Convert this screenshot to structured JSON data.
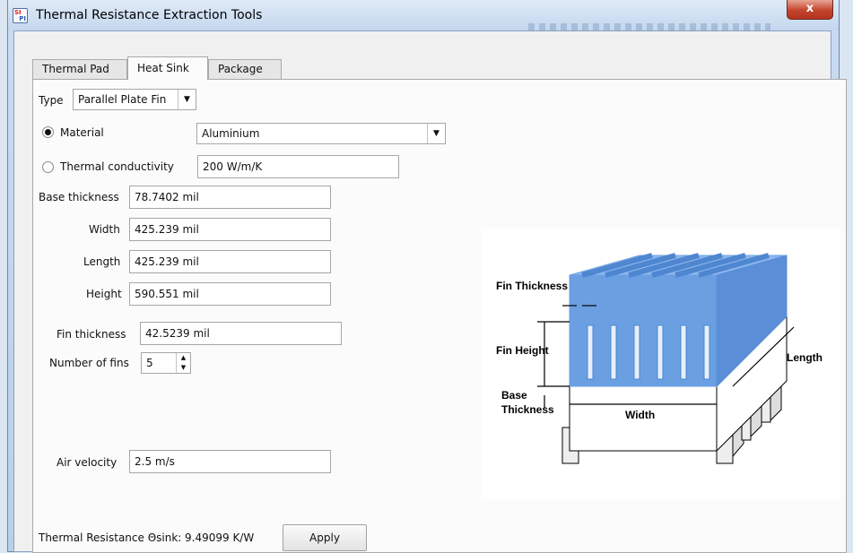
{
  "window": {
    "title": "Thermal Resistance Extraction Tools",
    "icon_text_top": "SI",
    "icon_text_bottom": "PI",
    "close_glyph": "x"
  },
  "tabs": [
    {
      "label": "Thermal Pad",
      "active": false
    },
    {
      "label": "Heat Sink",
      "active": true
    },
    {
      "label": "Package",
      "active": false
    }
  ],
  "form": {
    "type_label": "Type",
    "type_value": "Parallel Plate Fin",
    "material_label": "Material",
    "material_value": "Aluminium",
    "thermal_conductivity_label": "Thermal conductivity",
    "thermal_conductivity_value": "200 W/m/K",
    "base_thickness_label": "Base thickness",
    "base_thickness_value": "78.7402 mil",
    "width_label": "Width",
    "width_value": "425.239 mil",
    "length_label": "Length",
    "length_value": "425.239 mil",
    "height_label": "Height",
    "height_value": "590.551 mil",
    "fin_thickness_label": "Fin thickness",
    "fin_thickness_value": "42.5239 mil",
    "number_of_fins_label": "Number of fins",
    "number_of_fins_value": "5",
    "air_velocity_label": "Air velocity",
    "air_velocity_value": "2.5 m/s",
    "result_label": "Thermal Resistance Θsink:",
    "result_value": "9.49099 K/W",
    "apply_label": "Apply"
  },
  "diagram": {
    "fin_thickness": "Fin Thickness",
    "fin_height": "Fin Height",
    "base": "Base",
    "thickness": "Thickness",
    "width": "Width",
    "length": "Length",
    "fin_color": "#6a9fe2",
    "fin_dark_color": "#4f86d0",
    "base_color": "#ffffff"
  },
  "colors": {
    "close_button": "#c4442c",
    "title_bar": "#c4d7ee"
  }
}
